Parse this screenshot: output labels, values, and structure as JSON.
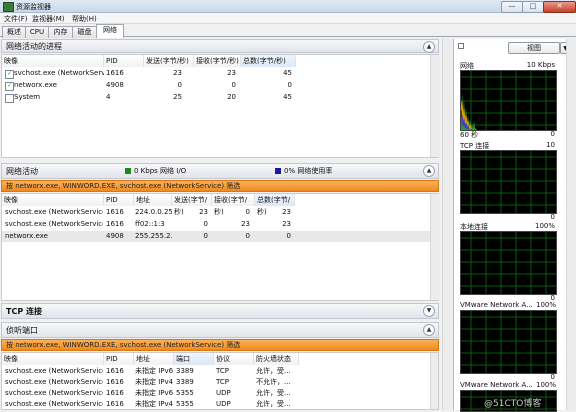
{
  "window": {
    "title": "资源监视器",
    "min": "—",
    "max": "□",
    "close": "✕"
  },
  "menu": [
    "文件(F)",
    "监视器(M)",
    "帮助(H)"
  ],
  "tabs": [
    "概述",
    "CPU",
    "内存",
    "磁盘",
    "网络"
  ],
  "active_tab": 4,
  "proc_section": {
    "title": "网络活动的进程",
    "columns": [
      "映像",
      "PID",
      "发送(字节/秒)",
      "接收(字节/秒)",
      "总数(字节/秒)"
    ],
    "rows": [
      {
        "checked": true,
        "name": "svchost.exe (NetworkService)",
        "pid": "1616",
        "send": "23",
        "recv": "23",
        "total": "45"
      },
      {
        "checked": true,
        "name": "networx.exe",
        "pid": "4908",
        "send": "0",
        "recv": "0",
        "total": "0"
      },
      {
        "checked": false,
        "name": "System",
        "pid": "4",
        "send": "25",
        "recv": "20",
        "total": "45"
      }
    ]
  },
  "net_section": {
    "title": "网络活动",
    "io_legend": "0 Kbps 网络 I/O",
    "usage_legend": "0% 网络使用率",
    "io_color": "#1a8a1a",
    "usage_color": "#1a1aa0",
    "filter": "按 networx.exe, WINWORD.EXE, svchost.exe (NetworkService) 筛选",
    "columns": [
      "映像",
      "PID",
      "地址",
      "发送(字节/秒)",
      "接收(字节/秒)",
      "总数(字节/秒)"
    ],
    "rows": [
      {
        "name": "svchost.exe (NetworkService)",
        "pid": "1616",
        "addr": "224.0.0.252",
        "send": "23",
        "recv": "0",
        "total": "23"
      },
      {
        "name": "svchost.exe (NetworkService)",
        "pid": "1616",
        "addr": "ff02::1:3",
        "send": "0",
        "recv": "23",
        "total": "23"
      },
      {
        "name": "networx.exe",
        "pid": "4908",
        "addr": "255.255.2...",
        "send": "0",
        "recv": "0",
        "total": "0"
      }
    ]
  },
  "tcp_section": {
    "title": "TCP 连接"
  },
  "listen_section": {
    "title": "侦听端口",
    "filter": "按 networx.exe, WINWORD.EXE, svchost.exe (NetworkService) 筛选",
    "columns": [
      "映像",
      "PID",
      "地址",
      "端口",
      "协议",
      "防火墙状态"
    ],
    "rows": [
      {
        "name": "svchost.exe (NetworkService)",
        "pid": "1616",
        "addr": "未指定 IPv6",
        "port": "3389",
        "proto": "TCP",
        "fw": "允许，受..."
      },
      {
        "name": "svchost.exe (NetworkService)",
        "pid": "1616",
        "addr": "未指定 IPv4",
        "port": "3389",
        "proto": "TCP",
        "fw": "不允许，..."
      },
      {
        "name": "svchost.exe (NetworkService)",
        "pid": "1616",
        "addr": "未指定 IPv6",
        "port": "5355",
        "proto": "UDP",
        "fw": "允许，受..."
      },
      {
        "name": "svchost.exe (NetworkService)",
        "pid": "1616",
        "addr": "未指定 IPv4",
        "port": "5355",
        "proto": "UDP",
        "fw": "允许，受..."
      }
    ]
  },
  "right": {
    "view_label": "视图",
    "graphs": [
      {
        "name": "网络",
        "max": "10 Kbps",
        "foot_left": "60 秒",
        "foot_right": "0"
      },
      {
        "name": "TCP 连接",
        "max": "10",
        "foot_left": "",
        "foot_right": "0"
      },
      {
        "name": "本地连接",
        "max": "100%",
        "foot_left": "",
        "foot_right": "0"
      },
      {
        "name": "VMware Network A...",
        "max": "100%",
        "foot_left": "",
        "foot_right": "0"
      },
      {
        "name": "VMware Network A...",
        "max": "100%",
        "foot_left": "",
        "foot_right": "0"
      }
    ]
  },
  "watermark": "@51CTO博客"
}
